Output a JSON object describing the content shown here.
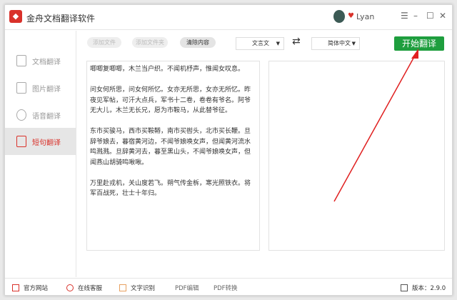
{
  "app": {
    "title": "金舟文档翻译软件",
    "user": "Lyan"
  },
  "sidebar": {
    "items": [
      {
        "label": "文档翻译"
      },
      {
        "label": "图片翻译"
      },
      {
        "label": "语音翻译"
      },
      {
        "label": "短句翻译",
        "active": true
      }
    ]
  },
  "toolbar": {
    "add_file": "添加文件",
    "add_folder": "添加文件夹",
    "clear": "清除内容",
    "source_lang": "文言文",
    "target_lang": "简体中文",
    "start": "开始翻译"
  },
  "source_text": [
    "唧唧复唧唧，木兰当户织。不闻机杼声，惟闻女叹息。",
    "问女何所思，问女何所忆。女亦无所思，女亦无所忆。昨夜见军帖，可汗大点兵，军书十二卷，卷卷有爷名。阿爷无大儿，木兰无长兄，愿为市鞍马，从此替爷征。",
    "东市买骏马，西市买鞍鞯，南市买辔头，北市买长鞭。旦辞爷娘去，暮宿黄河边，不闻爷娘唤女声，但闻黄河流水鸣溅溅。旦辞黄河去，暮至黑山头，不闻爷娘唤女声，但闻燕山胡骑鸣啾啾。",
    "万里赴戎机，关山度若飞。朔气传金柝，寒光照铁衣。将军百战死，壮士十年归。"
  ],
  "footer": {
    "website": "官方网站",
    "service": "在线客服",
    "ocr": "文字识别",
    "pdf_edit": "PDF编辑",
    "pdf_convert": "PDF转换",
    "version": "版本：2.9.0"
  },
  "colors": {
    "accent": "#d9312a",
    "start": "#1e9e3e"
  }
}
